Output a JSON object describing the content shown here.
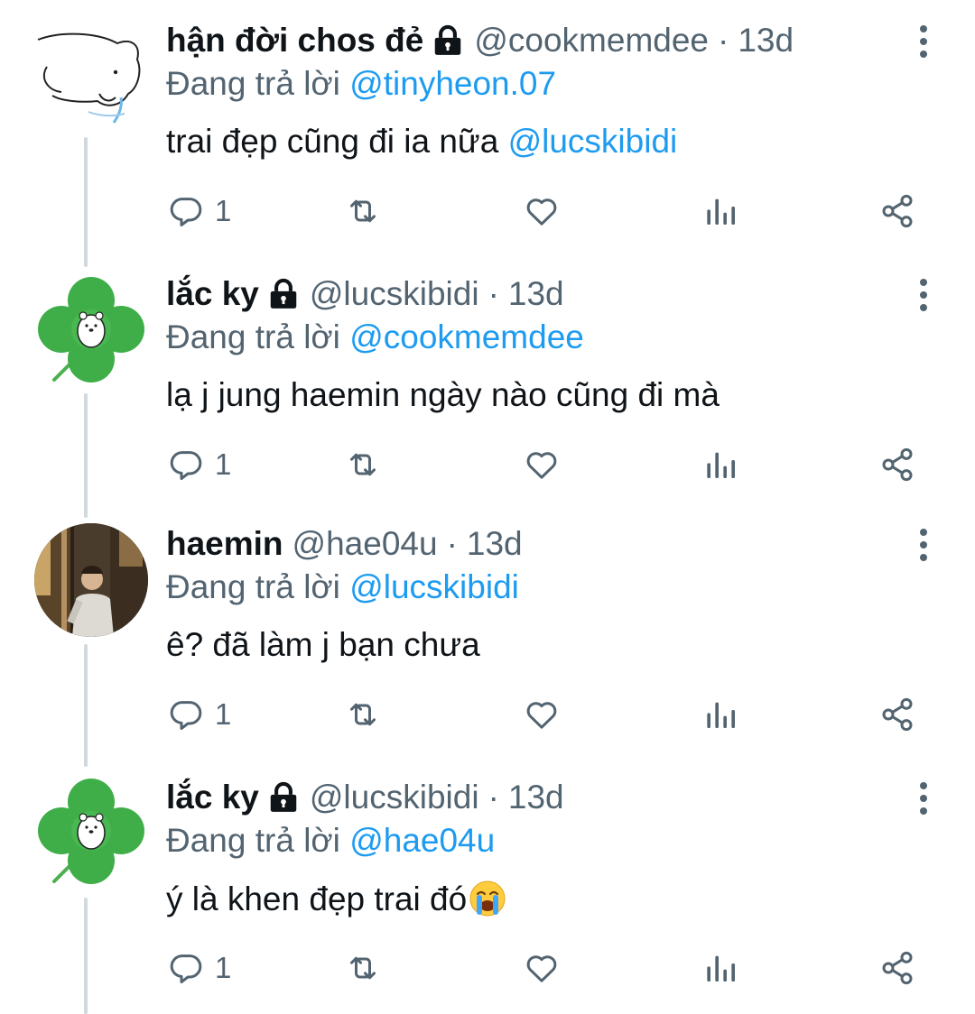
{
  "colors": {
    "accent": "#1d9bf0",
    "secondary_text": "#536471",
    "primary_text": "#0f1419",
    "thread_line": "#cfd9de"
  },
  "tweets": [
    {
      "display_name": "hận đời chos đẻ",
      "locked": true,
      "handle": "@cookmemdee",
      "separator": "·",
      "time": "13d",
      "reply_prefix": "Đang trả lời",
      "reply_to": "@tinyheon.07",
      "text": "trai đẹp cũng đi ia nữa",
      "text_mention": "@lucskibidi",
      "reply_count": "1",
      "avatar": "cartoon-sketch-avatar"
    },
    {
      "display_name": "lắc ky",
      "locked": true,
      "handle": "@lucskibidi",
      "separator": "·",
      "time": "13d",
      "reply_prefix": "Đang trả lời",
      "reply_to": "@cookmemdee",
      "text": "lạ j jung haemin ngày nào cũng đi mà",
      "text_mention": "",
      "reply_count": "1",
      "avatar": "clover-avatar"
    },
    {
      "display_name": "haemin",
      "locked": false,
      "handle": "@hae04u",
      "separator": "·",
      "time": "13d",
      "reply_prefix": "Đang trả lời",
      "reply_to": "@lucskibidi",
      "text": "ê? đã làm j bạn chưa",
      "text_mention": "",
      "reply_count": "1",
      "avatar": "photo-avatar"
    },
    {
      "display_name": "lắc ky",
      "locked": true,
      "handle": "@lucskibidi",
      "separator": "·",
      "time": "13d",
      "reply_prefix": "Đang trả lời",
      "reply_to": "@hae04u",
      "text": "ý là khen đẹp trai đó",
      "text_mention": "",
      "reply_count": "1",
      "avatar": "clover-avatar",
      "emoji": "crying-face-emoji"
    }
  ]
}
